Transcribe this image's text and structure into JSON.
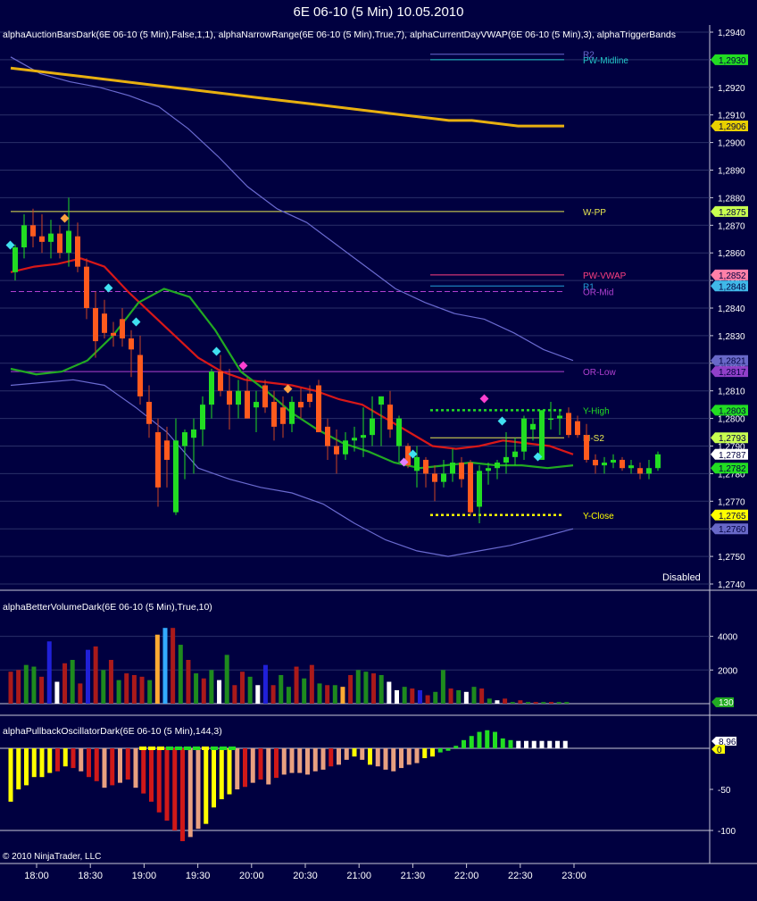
{
  "window": {
    "title": "6E 06-10 (5 Min)  10.05.2010"
  },
  "panels": {
    "price_header": "alphaAuctionBarsDark(6E 06-10 (5 Min),False,1,1), alphaNarrowRange(6E 06-10 (5 Min),True,7), alphaCurrentDayVWAP(6E 06-10 (5 Min),3), alphaTriggerBands",
    "volume_header": "alphaBetterVolumeDark(6E 06-10 (5 Min),True,10)",
    "oscillator_header": "alphaPullbackOscillatorDark(6E 06-10 (5 Min),144,3)",
    "status": "Disabled",
    "copyright": "© 2010 NinjaTrader, LLC"
  },
  "colors": {
    "background": "#000040",
    "grid": "#404878",
    "separator": "#c8c8d8",
    "up_bar": "#22dd22",
    "down_bar": "#ff5a1e",
    "vwap": "#e8b010",
    "red_ma": "#d81818",
    "green_ma": "#22aa22",
    "band": "#6a6ad0"
  },
  "chart_data": [
    {
      "type": "candlestick",
      "title": "6E 06-10 (5 Min)  10.05.2010",
      "x_tick_labels": [
        "18:00",
        "18:30",
        "19:00",
        "19:30",
        "20:00",
        "20:30",
        "21:00",
        "21:30",
        "22:00",
        "22:30",
        "23:00"
      ],
      "y_tick_labels": [
        "1,2940",
        "1,2930",
        "1,2920",
        "1,2910",
        "1,2900",
        "1,2890",
        "1,2880",
        "1,2870",
        "1,2860",
        "1,2850",
        "1,2840",
        "1,2830",
        "1,2820",
        "1,2810",
        "1,2800",
        "1,2790",
        "1,2780",
        "1,2770",
        "1,2760",
        "1,2750",
        "1,2740"
      ],
      "ylim": [
        1.2738,
        1.2942
      ],
      "ohlc": [
        [
          1.2853,
          1.2863,
          1.285,
          1.2862
        ],
        [
          1.2862,
          1.2874,
          1.2858,
          1.287
        ],
        [
          1.287,
          1.2876,
          1.2862,
          1.2866
        ],
        [
          1.2866,
          1.2874,
          1.286,
          1.2864
        ],
        [
          1.2864,
          1.2872,
          1.2858,
          1.2867
        ],
        [
          1.2867,
          1.287,
          1.2858,
          1.286
        ],
        [
          1.286,
          1.288,
          1.2855,
          1.2868
        ],
        [
          1.2866,
          1.2871,
          1.2853,
          1.2855
        ],
        [
          1.2855,
          1.2858,
          1.2836,
          1.284
        ],
        [
          1.284,
          1.2846,
          1.2822,
          1.2828
        ],
        [
          1.2838,
          1.2843,
          1.2829,
          1.2831
        ],
        [
          1.2831,
          1.2835,
          1.2826,
          1.283
        ],
        [
          1.2836,
          1.284,
          1.2826,
          1.2829
        ],
        [
          1.2829,
          1.2832,
          1.2815,
          1.2825
        ],
        [
          1.2823,
          1.283,
          1.2805,
          1.2808
        ],
        [
          1.2806,
          1.2812,
          1.2793,
          1.2798
        ],
        [
          1.2795,
          1.28,
          1.2768,
          1.2775
        ],
        [
          1.2792,
          1.2797,
          1.2775,
          1.2785
        ],
        [
          1.2766,
          1.28,
          1.2765,
          1.2792
        ],
        [
          1.279,
          1.2796,
          1.2778,
          1.2795
        ],
        [
          1.2793,
          1.28,
          1.278,
          1.2796
        ],
        [
          1.2796,
          1.2808,
          1.279,
          1.2805
        ],
        [
          1.2805,
          1.2818,
          1.28,
          1.2817
        ],
        [
          1.2817,
          1.2823,
          1.2808,
          1.281
        ],
        [
          1.281,
          1.2818,
          1.2796,
          1.2805
        ],
        [
          1.2805,
          1.2814,
          1.28,
          1.281
        ],
        [
          1.281,
          1.2815,
          1.28,
          1.28
        ],
        [
          1.2804,
          1.281,
          1.2795,
          1.2806
        ],
        [
          1.2812,
          1.2814,
          1.2802,
          1.2804
        ],
        [
          1.2806,
          1.281,
          1.2792,
          1.2797
        ],
        [
          1.2804,
          1.2808,
          1.2793,
          1.2798
        ],
        [
          1.2798,
          1.2808,
          1.2795,
          1.2806
        ],
        [
          1.2806,
          1.2811,
          1.28,
          1.2804
        ],
        [
          1.2809,
          1.2812,
          1.2804,
          1.2806
        ],
        [
          1.2812,
          1.2814,
          1.2795,
          1.2795
        ],
        [
          1.2797,
          1.28,
          1.2785,
          1.279
        ],
        [
          1.279,
          1.2796,
          1.278,
          1.2787
        ],
        [
          1.2787,
          1.2795,
          1.2785,
          1.2792
        ],
        [
          1.2792,
          1.2797,
          1.2788,
          1.2793
        ],
        [
          1.2793,
          1.2804,
          1.2786,
          1.2794
        ],
        [
          1.2794,
          1.2808,
          1.279,
          1.28
        ],
        [
          1.2805,
          1.2808,
          1.279,
          1.2808
        ],
        [
          1.2805,
          1.281,
          1.2793,
          1.2796
        ],
        [
          1.279,
          1.2801,
          1.2784,
          1.28
        ],
        [
          1.279,
          1.2791,
          1.2782,
          1.2783
        ],
        [
          1.2781,
          1.279,
          1.2775,
          1.2786
        ],
        [
          1.2785,
          1.2786,
          1.2775,
          1.278
        ],
        [
          1.278,
          1.2783,
          1.277,
          1.2777
        ],
        [
          1.2777,
          1.2785,
          1.2775,
          1.278
        ],
        [
          1.278,
          1.2789,
          1.2777,
          1.2784
        ],
        [
          1.2784,
          1.2786,
          1.2775,
          1.2778
        ],
        [
          1.2784,
          1.2785,
          1.2765,
          1.2766
        ],
        [
          1.2768,
          1.2783,
          1.2762,
          1.2781
        ],
        [
          1.2781,
          1.2784,
          1.2776,
          1.2782
        ],
        [
          1.2782,
          1.2785,
          1.2778,
          1.2784
        ],
        [
          1.2784,
          1.2795,
          1.278,
          1.2786
        ],
        [
          1.2786,
          1.2793,
          1.2783,
          1.2788
        ],
        [
          1.2788,
          1.2801,
          1.2785,
          1.28
        ],
        [
          1.2796,
          1.28,
          1.2792,
          1.2798
        ],
        [
          1.2785,
          1.2803,
          1.2785,
          1.2803
        ],
        [
          1.28,
          1.2806,
          1.2796,
          1.28
        ],
        [
          1.28,
          1.2803,
          1.2794,
          1.2801
        ],
        [
          1.2802,
          1.2804,
          1.2793,
          1.2794
        ],
        [
          1.2799,
          1.2801,
          1.2793,
          1.2794
        ],
        [
          1.2794,
          1.2798,
          1.2784,
          1.2785
        ],
        [
          1.2785,
          1.2787,
          1.278,
          1.2783
        ],
        [
          1.2783,
          1.2786,
          1.278,
          1.2784
        ],
        [
          1.2784,
          1.2787,
          1.2782,
          1.2785
        ],
        [
          1.2785,
          1.2786,
          1.2781,
          1.2782
        ],
        [
          1.2782,
          1.2785,
          1.278,
          1.2783
        ],
        [
          1.2782,
          1.2784,
          1.2778,
          1.278
        ],
        [
          1.278,
          1.2785,
          1.2778,
          1.2782
        ],
        [
          1.2782,
          1.2788,
          1.2781,
          1.2787
        ]
      ],
      "vwap": [
        1.2927,
        1.2926,
        1.2925,
        1.2924,
        1.2923,
        1.2922,
        1.2921,
        1.292,
        1.2919,
        1.2918,
        1.2917,
        1.2916,
        1.2915,
        1.2914,
        1.2913,
        1.2912,
        1.2911,
        1.291,
        1.2909,
        1.2908,
        1.2908,
        1.2907,
        1.2906,
        1.2906,
        1.2906
      ],
      "upper_band": [
        1.2931,
        1.2925,
        1.2922,
        1.292,
        1.2917,
        1.2913,
        1.2905,
        1.2895,
        1.2884,
        1.2876,
        1.2871,
        1.2863,
        1.2855,
        1.2847,
        1.2842,
        1.2838,
        1.2836,
        1.2831,
        1.2825,
        1.2821
      ],
      "lower_band": [
        1.2812,
        1.2813,
        1.2814,
        1.2812,
        1.2804,
        1.2795,
        1.2782,
        1.2778,
        1.2775,
        1.2773,
        1.2769,
        1.2762,
        1.2756,
        1.2752,
        1.275,
        1.2752,
        1.2754,
        1.2757,
        1.276
      ],
      "red_ma": [
        1.2853,
        1.2855,
        1.2856,
        1.2858,
        1.2855,
        1.2846,
        1.2838,
        1.283,
        1.2822,
        1.2817,
        1.2814,
        1.2813,
        1.2812,
        1.281,
        1.2807,
        1.2805,
        1.28,
        1.2795,
        1.279,
        1.2789,
        1.279,
        1.2792,
        1.2791,
        1.279,
        1.2787
      ],
      "green_ma": [
        1.2818,
        1.2816,
        1.2817,
        1.2821,
        1.283,
        1.2842,
        1.2847,
        1.2844,
        1.2832,
        1.2817,
        1.281,
        1.2802,
        1.2796,
        1.2791,
        1.2788,
        1.2784,
        1.2782,
        1.2783,
        1.2784,
        1.2783,
        1.2783,
        1.2782,
        1.2783
      ],
      "levels": [
        {
          "name": "PW-Midline",
          "price": 1.293,
          "tag": "1,2930",
          "color": "#23c8c8",
          "tag_color": "#22dd22"
        },
        {
          "name": "R2",
          "price": 1.2932,
          "tag": "",
          "color": "#6a6ad0",
          "tag_color": ""
        },
        {
          "name": "",
          "price": 1.2906,
          "tag": "1,2906",
          "color": "#e8b010",
          "tag_color": "#e8d000"
        },
        {
          "name": "W-PP",
          "price": 1.2875,
          "tag": "1,2875",
          "color": "#e8e850",
          "tag_color": "#c8ff50"
        },
        {
          "name": "PW-VWAP",
          "price": 1.2852,
          "tag": "1,2852",
          "color": "#ff4080",
          "tag_color": "#ff80a8"
        },
        {
          "name": "R1",
          "price": 1.2848,
          "tag": "1,2848",
          "color": "#23a0d8",
          "tag_color": "#40b8e8"
        },
        {
          "name": "OR-Mid",
          "price": 1.2846,
          "tag": "",
          "color": "#b040d0",
          "tag_color": ""
        },
        {
          "name": "",
          "price": 1.2821,
          "tag": "1,2821",
          "color": "#6a6ad0",
          "tag_color": "#6868c8"
        },
        {
          "name": "OR-Low",
          "price": 1.2817,
          "tag": "1,2817",
          "color": "#b040d0",
          "tag_color": "#9040c8"
        },
        {
          "name": "Y-High",
          "price": 1.2803,
          "tag": "1,2803",
          "color": "#22dd22",
          "tag_color": "#22dd22"
        },
        {
          "name": "M-S2",
          "price": 1.2793,
          "tag": "1,2793",
          "color": "#e8e850",
          "tag_color": "#c8ff50"
        },
        {
          "name": "",
          "price": 1.2787,
          "tag": "1,2787",
          "color": "#d81818",
          "tag_color": "#ffffff"
        },
        {
          "name": "",
          "price": 1.2782,
          "tag": "1,2782",
          "color": "#22aa22",
          "tag_color": "#22dd22"
        },
        {
          "name": "Y-Close",
          "price": 1.2765,
          "tag": "1,2765",
          "color": "#ffff00",
          "tag_color": "#ffff00"
        },
        {
          "name": "",
          "price": 1.276,
          "tag": "1,2760",
          "color": "#6a6ad0",
          "tag_color": "#6868c8"
        }
      ]
    },
    {
      "type": "bar",
      "title": "alphaBetterVolumeDark(6E 06-10 (5 Min),True,10)",
      "y_tick_labels": [
        "4000",
        "2000"
      ],
      "ylim": [
        0,
        5200
      ],
      "last_value_tag": "130",
      "values": [
        1900,
        2000,
        2300,
        2200,
        1600,
        3700,
        1300,
        2400,
        2600,
        1200,
        3200,
        3400,
        2000,
        2600,
        1400,
        1800,
        1700,
        1600,
        1400,
        4100,
        4500,
        4500,
        3500,
        2600,
        1800,
        1500,
        2000,
        1400,
        2900,
        1100,
        1900,
        1600,
        1100,
        2300,
        1100,
        1700,
        1000,
        2200,
        1500,
        2300,
        1200,
        1100,
        1100,
        1000,
        1700,
        2000,
        1900,
        1800,
        1700,
        1300,
        800,
        1000,
        900,
        800,
        500,
        700,
        2000,
        900,
        800,
        700,
        1000,
        900,
        300,
        200,
        300,
        100,
        200,
        100,
        100,
        100,
        100,
        100,
        100
      ],
      "bar_colors": [
        "#aa1a1a",
        "#aa1a1a",
        "#1e8a1e",
        "#1e8a1e",
        "#aa1a1a",
        "#2020d8",
        "#ffffff",
        "#aa1a1a",
        "#1e8a1e",
        "#aa1a1a",
        "#2020d8",
        "#aa1a1a",
        "#1e8a1e",
        "#aa1a1a",
        "#1e8a1e",
        "#aa1a1a",
        "#aa1a1a",
        "#aa1a1a",
        "#1e8a1e",
        "#ffaa33",
        "#33aaff",
        "#aa1a1a",
        "#1e8a1e",
        "#aa1a1a",
        "#1e8a1e",
        "#aa1a1a",
        "#1e8a1e",
        "#ffffff",
        "#1e8a1e",
        "#aa1a1a",
        "#aa1a1a",
        "#1e8a1e",
        "#ffffff",
        "#2020d8",
        "#aa1a1a",
        "#1e8a1e",
        "#1e8a1e",
        "#aa1a1a",
        "#1e8a1e",
        "#aa1a1a",
        "#1e8a1e",
        "#aa1a1a",
        "#1e8a1e",
        "#ffaa33",
        "#aa1a1a",
        "#1e8a1e",
        "#1e8a1e",
        "#aa1a1a",
        "#1e8a1e",
        "#ffffff",
        "#ffffff",
        "#1e8a1e",
        "#aa1a1a",
        "#2020d8",
        "#aa1a1a",
        "#1e8a1e",
        "#1e8a1e",
        "#aa1a1a",
        "#1e8a1e",
        "#ffffff",
        "#1e8a1e",
        "#aa1a1a",
        "#1e8a1e",
        "#ffffff",
        "#aa1a1a",
        "#1e8a1e",
        "#aa1a1a",
        "#1e8a1e",
        "#aa1a1a",
        "#1e8a1e",
        "#aa1a1a",
        "#1e8a1e",
        "#1e8a1e"
      ]
    },
    {
      "type": "bar",
      "title": "alphaPullbackOscillatorDark(6E 06-10 (5 Min),144,3)",
      "y_tick_labels": [
        "-50",
        "-100"
      ],
      "ylim": [
        -128,
        14
      ],
      "last_value_tags": [
        "8,96",
        "0"
      ],
      "values": [
        -65,
        -50,
        -45,
        -35,
        -35,
        -30,
        -28,
        -22,
        -24,
        -28,
        -35,
        -40,
        -48,
        -45,
        -42,
        -38,
        -48,
        -55,
        -65,
        -78,
        -88,
        -100,
        -113,
        -108,
        -98,
        -92,
        -72,
        -62,
        -56,
        -50,
        -47,
        -42,
        -38,
        -44,
        -36,
        -32,
        -30,
        -30,
        -32,
        -28,
        -26,
        -22,
        -20,
        -14,
        -10,
        -14,
        -20,
        -22,
        -26,
        -28,
        -24,
        -20,
        -18,
        -12,
        -10,
        -5,
        -3,
        3,
        10,
        15,
        20,
        22,
        20,
        12,
        10,
        9,
        9,
        9,
        9,
        9,
        9,
        9
      ],
      "bar_colors": [
        "#ffff00",
        "#ffff00",
        "#ffff00",
        "#ffff00",
        "#ffff00",
        "#ffff00",
        "#d01818",
        "#ffff00",
        "#d01818",
        "#e8a080",
        "#d01818",
        "#d01818",
        "#e8a080",
        "#d01818",
        "#e8a080",
        "#d01818",
        "#e8a080",
        "#d01818",
        "#d01818",
        "#d01818",
        "#d01818",
        "#d01818",
        "#d01818",
        "#e8a080",
        "#e8a080",
        "#ffff00",
        "#ffff00",
        "#ffff00",
        "#ffff00",
        "#e8a080",
        "#d01818",
        "#e8a080",
        "#d01818",
        "#e8a080",
        "#d01818",
        "#e8a080",
        "#e8a080",
        "#e8a080",
        "#e8a080",
        "#e8a080",
        "#e8a080",
        "#d01818",
        "#e8a080",
        "#e8a080",
        "#ffff00",
        "#e8a080",
        "#ffff00",
        "#e8a080",
        "#e8a080",
        "#e8a080",
        "#e8a080",
        "#e8a080",
        "#e8a080",
        "#ffff00",
        "#ffff00",
        "#22dd22",
        "#22dd22",
        "#22dd22",
        "#22dd22",
        "#22dd22",
        "#22dd22",
        "#22dd22",
        "#22dd22",
        "#22dd22",
        "#22dd22",
        "#ffffff",
        "#ffffff",
        "#ffffff",
        "#ffffff",
        "#ffffff",
        "#ffffff",
        "#ffffff"
      ],
      "zero_markers": [
        "#ffff00",
        "#ffff00",
        "#ffff00",
        "#22dd22",
        "#22dd22",
        "#22dd22",
        "#22dd22",
        "#ffff00",
        "#22dd22",
        "#22dd22",
        "#22dd22"
      ]
    }
  ]
}
